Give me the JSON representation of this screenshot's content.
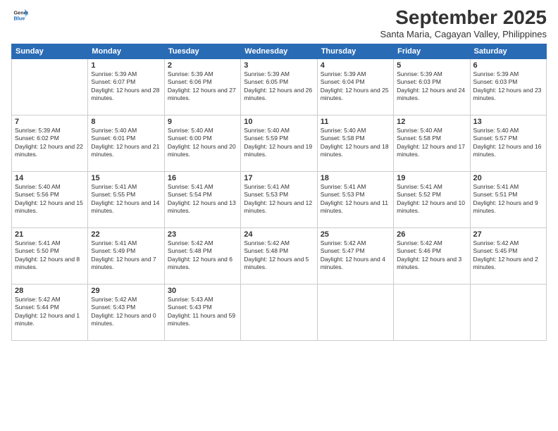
{
  "header": {
    "logo_general": "General",
    "logo_blue": "Blue",
    "month": "September 2025",
    "location": "Santa Maria, Cagayan Valley, Philippines"
  },
  "days_of_week": [
    "Sunday",
    "Monday",
    "Tuesday",
    "Wednesday",
    "Thursday",
    "Friday",
    "Saturday"
  ],
  "weeks": [
    [
      {
        "day": "",
        "sunrise": "",
        "sunset": "",
        "daylight": ""
      },
      {
        "day": "1",
        "sunrise": "Sunrise: 5:39 AM",
        "sunset": "Sunset: 6:07 PM",
        "daylight": "Daylight: 12 hours and 28 minutes."
      },
      {
        "day": "2",
        "sunrise": "Sunrise: 5:39 AM",
        "sunset": "Sunset: 6:06 PM",
        "daylight": "Daylight: 12 hours and 27 minutes."
      },
      {
        "day": "3",
        "sunrise": "Sunrise: 5:39 AM",
        "sunset": "Sunset: 6:05 PM",
        "daylight": "Daylight: 12 hours and 26 minutes."
      },
      {
        "day": "4",
        "sunrise": "Sunrise: 5:39 AM",
        "sunset": "Sunset: 6:04 PM",
        "daylight": "Daylight: 12 hours and 25 minutes."
      },
      {
        "day": "5",
        "sunrise": "Sunrise: 5:39 AM",
        "sunset": "Sunset: 6:03 PM",
        "daylight": "Daylight: 12 hours and 24 minutes."
      },
      {
        "day": "6",
        "sunrise": "Sunrise: 5:39 AM",
        "sunset": "Sunset: 6:03 PM",
        "daylight": "Daylight: 12 hours and 23 minutes."
      }
    ],
    [
      {
        "day": "7",
        "sunrise": "Sunrise: 5:39 AM",
        "sunset": "Sunset: 6:02 PM",
        "daylight": "Daylight: 12 hours and 22 minutes."
      },
      {
        "day": "8",
        "sunrise": "Sunrise: 5:40 AM",
        "sunset": "Sunset: 6:01 PM",
        "daylight": "Daylight: 12 hours and 21 minutes."
      },
      {
        "day": "9",
        "sunrise": "Sunrise: 5:40 AM",
        "sunset": "Sunset: 6:00 PM",
        "daylight": "Daylight: 12 hours and 20 minutes."
      },
      {
        "day": "10",
        "sunrise": "Sunrise: 5:40 AM",
        "sunset": "Sunset: 5:59 PM",
        "daylight": "Daylight: 12 hours and 19 minutes."
      },
      {
        "day": "11",
        "sunrise": "Sunrise: 5:40 AM",
        "sunset": "Sunset: 5:58 PM",
        "daylight": "Daylight: 12 hours and 18 minutes."
      },
      {
        "day": "12",
        "sunrise": "Sunrise: 5:40 AM",
        "sunset": "Sunset: 5:58 PM",
        "daylight": "Daylight: 12 hours and 17 minutes."
      },
      {
        "day": "13",
        "sunrise": "Sunrise: 5:40 AM",
        "sunset": "Sunset: 5:57 PM",
        "daylight": "Daylight: 12 hours and 16 minutes."
      }
    ],
    [
      {
        "day": "14",
        "sunrise": "Sunrise: 5:40 AM",
        "sunset": "Sunset: 5:56 PM",
        "daylight": "Daylight: 12 hours and 15 minutes."
      },
      {
        "day": "15",
        "sunrise": "Sunrise: 5:41 AM",
        "sunset": "Sunset: 5:55 PM",
        "daylight": "Daylight: 12 hours and 14 minutes."
      },
      {
        "day": "16",
        "sunrise": "Sunrise: 5:41 AM",
        "sunset": "Sunset: 5:54 PM",
        "daylight": "Daylight: 12 hours and 13 minutes."
      },
      {
        "day": "17",
        "sunrise": "Sunrise: 5:41 AM",
        "sunset": "Sunset: 5:53 PM",
        "daylight": "Daylight: 12 hours and 12 minutes."
      },
      {
        "day": "18",
        "sunrise": "Sunrise: 5:41 AM",
        "sunset": "Sunset: 5:53 PM",
        "daylight": "Daylight: 12 hours and 11 minutes."
      },
      {
        "day": "19",
        "sunrise": "Sunrise: 5:41 AM",
        "sunset": "Sunset: 5:52 PM",
        "daylight": "Daylight: 12 hours and 10 minutes."
      },
      {
        "day": "20",
        "sunrise": "Sunrise: 5:41 AM",
        "sunset": "Sunset: 5:51 PM",
        "daylight": "Daylight: 12 hours and 9 minutes."
      }
    ],
    [
      {
        "day": "21",
        "sunrise": "Sunrise: 5:41 AM",
        "sunset": "Sunset: 5:50 PM",
        "daylight": "Daylight: 12 hours and 8 minutes."
      },
      {
        "day": "22",
        "sunrise": "Sunrise: 5:41 AM",
        "sunset": "Sunset: 5:49 PM",
        "daylight": "Daylight: 12 hours and 7 minutes."
      },
      {
        "day": "23",
        "sunrise": "Sunrise: 5:42 AM",
        "sunset": "Sunset: 5:48 PM",
        "daylight": "Daylight: 12 hours and 6 minutes."
      },
      {
        "day": "24",
        "sunrise": "Sunrise: 5:42 AM",
        "sunset": "Sunset: 5:48 PM",
        "daylight": "Daylight: 12 hours and 5 minutes."
      },
      {
        "day": "25",
        "sunrise": "Sunrise: 5:42 AM",
        "sunset": "Sunset: 5:47 PM",
        "daylight": "Daylight: 12 hours and 4 minutes."
      },
      {
        "day": "26",
        "sunrise": "Sunrise: 5:42 AM",
        "sunset": "Sunset: 5:46 PM",
        "daylight": "Daylight: 12 hours and 3 minutes."
      },
      {
        "day": "27",
        "sunrise": "Sunrise: 5:42 AM",
        "sunset": "Sunset: 5:45 PM",
        "daylight": "Daylight: 12 hours and 2 minutes."
      }
    ],
    [
      {
        "day": "28",
        "sunrise": "Sunrise: 5:42 AM",
        "sunset": "Sunset: 5:44 PM",
        "daylight": "Daylight: 12 hours and 1 minute."
      },
      {
        "day": "29",
        "sunrise": "Sunrise: 5:42 AM",
        "sunset": "Sunset: 5:43 PM",
        "daylight": "Daylight: 12 hours and 0 minutes."
      },
      {
        "day": "30",
        "sunrise": "Sunrise: 5:43 AM",
        "sunset": "Sunset: 5:43 PM",
        "daylight": "Daylight: 11 hours and 59 minutes."
      },
      {
        "day": "",
        "sunrise": "",
        "sunset": "",
        "daylight": ""
      },
      {
        "day": "",
        "sunrise": "",
        "sunset": "",
        "daylight": ""
      },
      {
        "day": "",
        "sunrise": "",
        "sunset": "",
        "daylight": ""
      },
      {
        "day": "",
        "sunrise": "",
        "sunset": "",
        "daylight": ""
      }
    ]
  ]
}
